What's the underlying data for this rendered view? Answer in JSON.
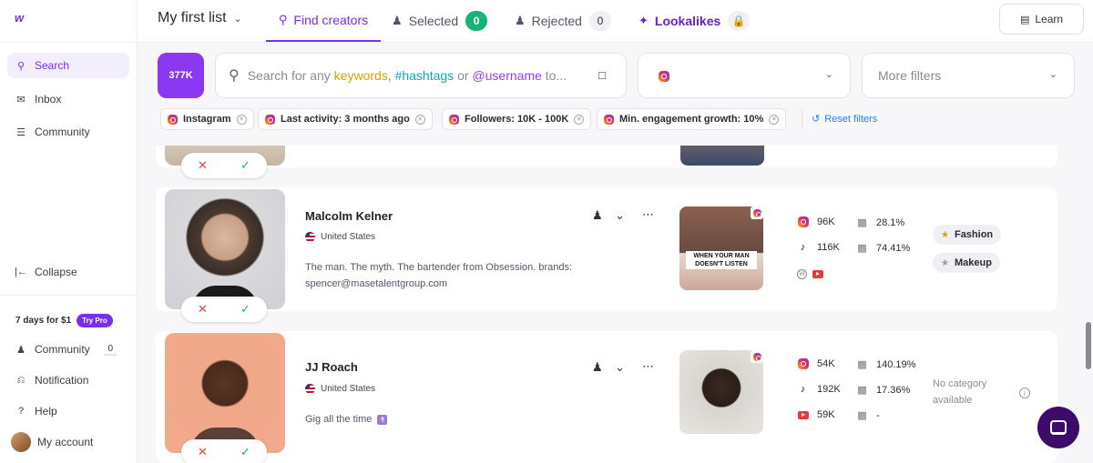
{
  "sidebar": {
    "items": [
      {
        "label": "Search",
        "icon": "search-icon"
      },
      {
        "label": "Inbox",
        "icon": "inbox-icon"
      },
      {
        "label": "Community",
        "icon": "list-icon"
      }
    ],
    "collapse_label": "Collapse",
    "trial_text": "7 days for $1",
    "try_pro_label": "Try Pro",
    "bottom_items": [
      {
        "label": "Community",
        "count": "0"
      },
      {
        "label": "Notification"
      },
      {
        "label": "Help"
      },
      {
        "label": "My account"
      }
    ]
  },
  "topbar": {
    "list_title": "My first list",
    "tabs": {
      "find": "Find creators",
      "selected": "Selected",
      "selected_count": "0",
      "rejected": "Rejected",
      "rejected_count": "0",
      "lookalikes": "Lookalikes"
    },
    "learn_label": "Learn"
  },
  "filters": {
    "total_count": "377K",
    "search": {
      "pre": "Search for any ",
      "kw1": "keywords",
      "sep1": ", ",
      "kw2": "#hashtags",
      "sep2": " or ",
      "kw3": "@username",
      "post": " to..."
    },
    "more_filters_label": "More filters",
    "chips": [
      "Instagram",
      "Last activity: 3 months ago",
      "Followers: 10K - 100K",
      "Min. engagement growth: 10%"
    ],
    "reset_label": "Reset filters"
  },
  "creators": [
    {
      "name": "Malcolm Kelner",
      "country": "United States",
      "bio_line1": "The man. The myth. The bartender from Obsession. brands:",
      "bio_line2": "spencer@masetalentgroup.com",
      "post_caption": "WHEN YOUR MAN DOESN'T LISTEN",
      "stats": [
        {
          "followers": "96K",
          "engagement": "28.1%"
        },
        {
          "followers": "116K",
          "engagement": "74.41%"
        }
      ],
      "categories": [
        "Fashion",
        "Makeup"
      ]
    },
    {
      "name": "JJ Roach",
      "country": "United States",
      "bio_line1": "Gig all the time",
      "stats": [
        {
          "followers": "54K",
          "engagement": "140.19%"
        },
        {
          "followers": "192K",
          "engagement": "17.36%"
        },
        {
          "followers": "59K",
          "engagement": "-"
        }
      ],
      "no_category_line1": "No category",
      "no_category_line2": "available"
    }
  ],
  "colors": {
    "accent": "#7b2cf0",
    "success": "#16b27a",
    "danger": "#e04848",
    "link": "#2c7be5"
  }
}
